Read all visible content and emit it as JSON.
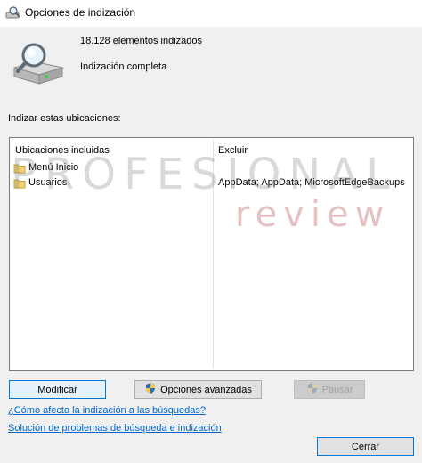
{
  "window": {
    "title": "Opciones de indización",
    "icon": "indexing-options-icon"
  },
  "status": {
    "count_text": "18.128 elementos indizados",
    "state_text": "Indización completa.",
    "icon": "magnifier-over-drive-icon"
  },
  "locations": {
    "label": "Indizar estas ubicaciones:",
    "columns": {
      "included": "Ubicaciones incluidas",
      "exclude": "Excluir"
    },
    "rows": [
      {
        "name": "Menú Inicio",
        "exclude": "",
        "icon": "folder-icon"
      },
      {
        "name": "Usuarios",
        "exclude": "AppData; AppData; MicrosoftEdgeBackups",
        "icon": "folder-icon"
      }
    ]
  },
  "watermark": {
    "main": "PROFESIONAL",
    "sub": "review"
  },
  "buttons": {
    "modify": "Modificar",
    "advanced": "Opciones avanzadas",
    "pause": "Pausar",
    "close": "Cerrar"
  },
  "links": {
    "help": "¿Cómo afecta la indización a las búsquedas?",
    "troubleshoot": "Solución de problemas de búsqueda e indización"
  },
  "colors": {
    "link": "#0066cc",
    "focus_border": "#0078d7",
    "shield_blue": "#2f6db5",
    "shield_yellow": "#f2c94c"
  }
}
